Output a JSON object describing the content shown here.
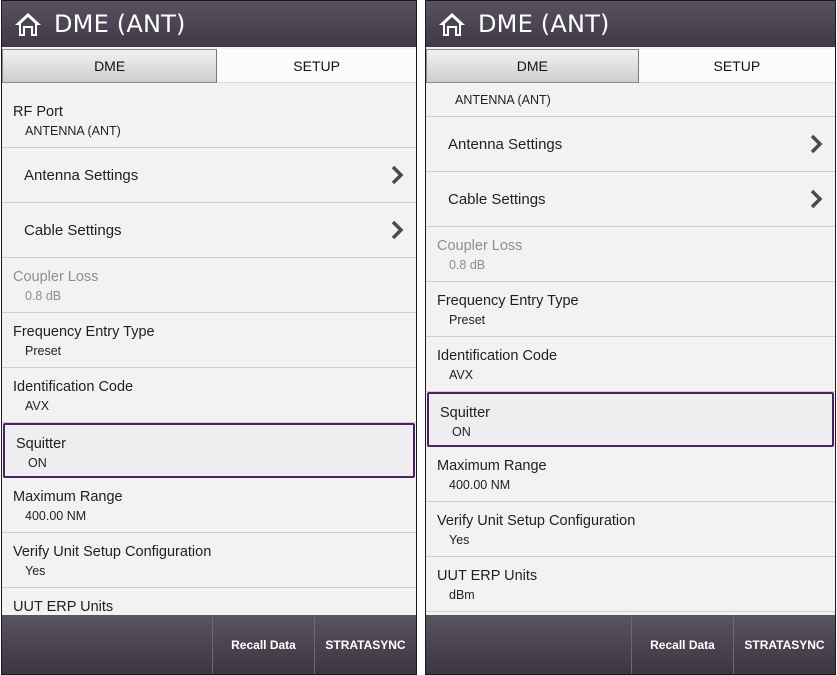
{
  "left": {
    "title": "DME (ANT)",
    "tabs": [
      "DME",
      "SETUP"
    ],
    "rows": {
      "rf_port_label": "RF Port",
      "rf_port_value": "ANTENNA (ANT)",
      "antenna_settings": "Antenna Settings",
      "cable_settings": "Cable Settings",
      "coupler_loss_label": "Coupler Loss",
      "coupler_loss_value": "0.8 dB",
      "freq_entry_label": "Frequency Entry Type",
      "freq_entry_value": "Preset",
      "ident_label": "Identification Code",
      "ident_value": "AVX",
      "squitter_label": "Squitter",
      "squitter_value": "ON",
      "max_range_label": "Maximum Range",
      "max_range_value": "400.00 NM",
      "verify_label": "Verify Unit Setup Configuration",
      "verify_value": "Yes",
      "uut_label": "UUT ERP Units"
    },
    "footer": {
      "recall": "Recall Data",
      "stratasync": "STRATASYNC"
    }
  },
  "right": {
    "title": "DME (ANT)",
    "tabs": [
      "DME",
      "SETUP"
    ],
    "rows": {
      "rf_port_value": "ANTENNA (ANT)",
      "antenna_settings": "Antenna Settings",
      "cable_settings": "Cable Settings",
      "coupler_loss_label": "Coupler Loss",
      "coupler_loss_value": "0.8 dB",
      "freq_entry_label": "Frequency Entry Type",
      "freq_entry_value": "Preset",
      "ident_label": "Identification Code",
      "ident_value": "AVX",
      "squitter_label": "Squitter",
      "squitter_value": "ON",
      "max_range_label": "Maximum Range",
      "max_range_value": "400.00 NM",
      "verify_label": "Verify Unit Setup Configuration",
      "verify_value": "Yes",
      "uut_label": "UUT ERP Units",
      "uut_value": "dBm"
    },
    "footer": {
      "recall": "Recall Data",
      "stratasync": "STRATASYNC"
    }
  },
  "colors": {
    "titlebar": "#4b4453",
    "selection_border": "#4d2066",
    "background": "#f2f2f2"
  },
  "icons": [
    "home-icon",
    "chevron-right-icon"
  ]
}
